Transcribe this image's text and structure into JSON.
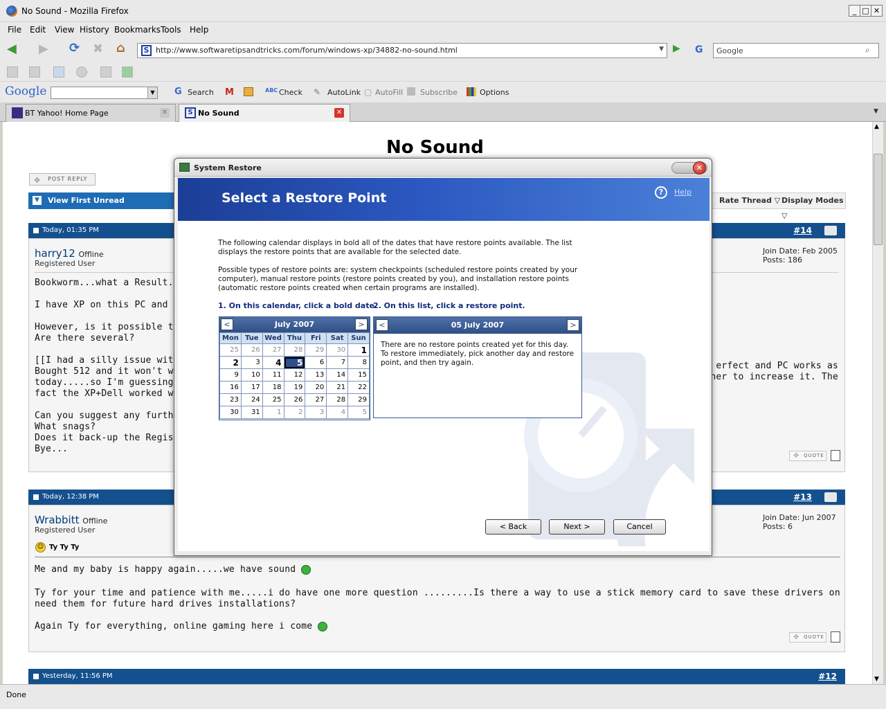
{
  "window": {
    "title": "No Sound - Mozilla Firefox",
    "min_label": "_",
    "max_label": "□",
    "close_label": "✕"
  },
  "menu": [
    "File",
    "Edit",
    "View",
    "History",
    "Bookmarks",
    "Tools",
    "Help"
  ],
  "nav": {
    "url": "http://www.softwaretipsandtricks.com/forum/windows-xp/34882-no-sound.html",
    "search_value": "Google"
  },
  "google_toolbar": {
    "logo": "Google",
    "search_label": "Search",
    "check_label": "Check",
    "autolink_label": "AutoLink",
    "autofill_label": "AutoFill",
    "subscribe_label": "Subscribe",
    "options_label": "Options"
  },
  "tabs": [
    {
      "label": "BT Yahoo! Home Page"
    },
    {
      "label": "No Sound"
    }
  ],
  "page": {
    "heading": "No Sound",
    "post_reply": "POST REPLY",
    "view_first_unread": "View First Unread",
    "rate_thread": "Rate Thread",
    "display_modes": "Display Modes",
    "quote_label": "QUOTE",
    "posts": [
      {
        "date": "Today, 01:35 PM",
        "number": "#14",
        "user": "harry12",
        "status": "Offline",
        "role": "Registered User",
        "join": "Join Date: Feb 2005",
        "posts": "Posts: 186",
        "lines": [
          "Bookworm...what a Result...so",
          "",
          "I have XP on this PC and note",
          "",
          "However, is it possible to see",
          "Are there several?",
          "",
          "[[I had a silly issue with memo",
          "Bought 512 and it won't work",
          "today.....so I'm guessing mem",
          "fact the XP+Dell worked with",
          "",
          "Can you suggest any further c",
          "What snags?",
          "Does it back-up the Registry,",
          "Bye..."
        ],
        "right_lines": [
          "erfect and PC works as",
          "t bother to increase it. The"
        ]
      },
      {
        "date": "Today, 12:38 PM",
        "number": "#13",
        "user": "Wrabbitt",
        "status": "Offline",
        "role": "Registered User",
        "join": "Join Date: Jun 2007",
        "posts": "Posts: 6",
        "subject": "Ty Ty Ty",
        "lines": [
          "Me and my baby is happy again.....we have sound",
          "",
          "Ty for your time and patience with me.....i do have one more question .........Is there a way to use a stick memory card to save these drivers on so i can download them if i",
          "need them for future hard drives installations?",
          "",
          "Again Ty for everything, online gaming here i come"
        ]
      },
      {
        "date": "Yesterday, 11:56 PM",
        "number": "#12"
      }
    ]
  },
  "status": "Done",
  "dialog": {
    "title": "System Restore",
    "heading": "Select a Restore Point",
    "help": "Help",
    "para1": "The following calendar displays in bold all of the dates that have restore points available. The list displays the restore points that are available for the selected date.",
    "para2": "Possible types of restore points are: system checkpoints (scheduled restore points created by your computer), manual restore points (restore points created by you), and installation restore points (automatic restore points created when certain programs are installed).",
    "step1": "1. On this calendar, click a bold date.",
    "step2": "2. On this list, click a restore point.",
    "calendar": {
      "month": "July 2007",
      "prev": "<",
      "next": ">",
      "days": [
        "Mon",
        "Tue",
        "Wed",
        "Thu",
        "Fri",
        "Sat",
        "Sun"
      ],
      "weeks": [
        [
          {
            "d": "25",
            "o": true
          },
          {
            "d": "26",
            "o": true
          },
          {
            "d": "27",
            "o": true
          },
          {
            "d": "28",
            "o": true
          },
          {
            "d": "29",
            "o": true
          },
          {
            "d": "30",
            "o": true
          },
          {
            "d": "1",
            "b": true
          }
        ],
        [
          {
            "d": "2",
            "b": true
          },
          {
            "d": "3"
          },
          {
            "d": "4",
            "b": true
          },
          {
            "d": "5",
            "sel": true
          },
          {
            "d": "6"
          },
          {
            "d": "7"
          },
          {
            "d": "8"
          }
        ],
        [
          {
            "d": "9"
          },
          {
            "d": "10"
          },
          {
            "d": "11"
          },
          {
            "d": "12"
          },
          {
            "d": "13"
          },
          {
            "d": "14"
          },
          {
            "d": "15"
          }
        ],
        [
          {
            "d": "16"
          },
          {
            "d": "17"
          },
          {
            "d": "18"
          },
          {
            "d": "19"
          },
          {
            "d": "20"
          },
          {
            "d": "21"
          },
          {
            "d": "22"
          }
        ],
        [
          {
            "d": "23"
          },
          {
            "d": "24"
          },
          {
            "d": "25"
          },
          {
            "d": "26"
          },
          {
            "d": "27"
          },
          {
            "d": "28"
          },
          {
            "d": "29"
          }
        ],
        [
          {
            "d": "30"
          },
          {
            "d": "31"
          },
          {
            "d": "1",
            "o": true
          },
          {
            "d": "2",
            "o": true
          },
          {
            "d": "3",
            "o": true
          },
          {
            "d": "4",
            "o": true
          },
          {
            "d": "5",
            "o": true
          }
        ]
      ]
    },
    "list": {
      "date": "05 July 2007",
      "prev": "<",
      "next": ">",
      "message": "There are no restore points created yet for this day. To restore immediately, pick another day and restore point, and then try again."
    },
    "buttons": {
      "back": "< Back",
      "next": "Next >",
      "cancel": "Cancel"
    }
  }
}
